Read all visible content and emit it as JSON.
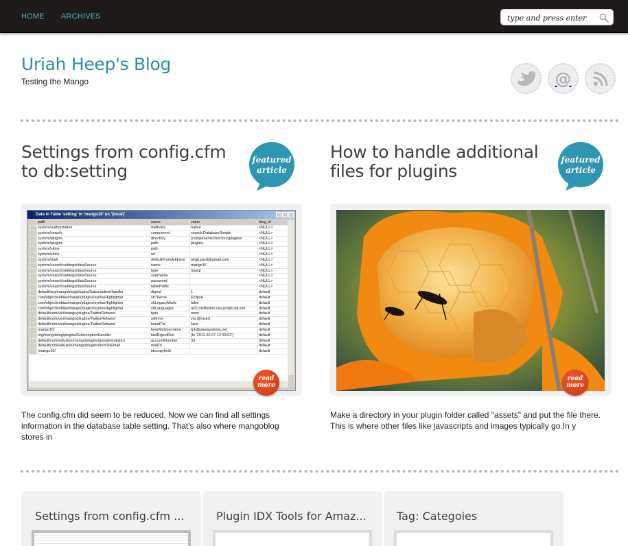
{
  "nav": {
    "home": "HOME",
    "archives": "ARCHIVES"
  },
  "search": {
    "placeholder": "type and press enter"
  },
  "site": {
    "title": "Uriah Heep's Blog",
    "tagline": "Testing the Mango"
  },
  "social": [
    "twitter-icon",
    "email-icon",
    "rss-icon"
  ],
  "badge": {
    "line1": "featured",
    "line2": "article"
  },
  "readmore": {
    "line1": "read",
    "line2": "more"
  },
  "featured": [
    {
      "title": "Settings from config.cfm to db:setting",
      "excerpt": "The config.cfm did seem to be reduced. Now we can find all settings information in the database table setting. That's also where mangoblog stores in"
    },
    {
      "title": "How to handle additional files for plugins",
      "excerpt": "Make a directory in your plugin folder called \"assets\" and put the file there. This is where other files like javascripts and images typically go.In y"
    }
  ],
  "cards": [
    {
      "title": "Settings from config.cfm ..."
    },
    {
      "title": "Plugin IDX Tools for Amaz..."
    },
    {
      "title": "Tag: Categoies"
    }
  ],
  "screenshot": {
    "window_title": "Data in Table 'setting' in 'mango16' on '(local)'",
    "columns": [
      "path",
      "name",
      "value",
      "blog_id"
    ],
    "rows": [
      [
        "system/authorization",
        "methods",
        "native",
        "<NULL>"
      ],
      [
        "system/search",
        "component",
        "search.DatabaseSimple",
        "<NULL>"
      ],
      [
        "system/plugins",
        "directory",
        "{componentsDirectory}plugins/",
        "<NULL>"
      ],
      [
        "system/plugins",
        "path",
        "plugins.",
        "<NULL>"
      ],
      [
        "system/skins",
        "path",
        "",
        "<NULL>"
      ],
      [
        "system/skins",
        "url",
        "",
        "<NULL>"
      ],
      [
        "system/mail",
        "defaultFromAddress",
        "birgit.pauli@gmail.com",
        "<NULL>"
      ],
      [
        "system/search/settings/dataSource",
        "name",
        "mango16",
        "<NULL>"
      ],
      [
        "system/search/settings/dataSource",
        "type",
        "mssql",
        "<NULL>"
      ],
      [
        "system/search/settings/dataSource",
        "username",
        "",
        "<NULL>"
      ],
      [
        "system/search/settings/dataSource",
        "password",
        "",
        "<NULL>"
      ],
      [
        "system/search/settings/dataSource",
        "tablePrefix",
        "",
        "<NULL>"
      ],
      [
        "default/org/mangoblog/plugins/SubscriptionHandler",
        "digest",
        "1",
        "default"
      ],
      [
        "com/objectivebias/mango/plugins/syntaxHighlighter",
        "shTheme",
        "Eclipse",
        "default"
      ],
      [
        "com/objectivebias/mango/plugins/syntaxHighlighter",
        "shLegacyMode",
        "false",
        "default"
      ],
      [
        "com/objectivebias/mango/plugins/syntaxHighlighter",
        "shLanguages",
        "as3,coldfusion,css,jscript,sql,xml",
        "default"
      ],
      [
        "default/com/visi/mango/plugins/TwitterRetweet",
        "type",
        "none",
        "default"
      ],
      [
        "default/com/visi/mango/plugins/TwitterRetweet",
        "referrer",
        "via @{user}",
        "default"
      ],
      [
        "default/com/visi/mango/plugins/TwitterRetweet",
        "tweetTxt",
        "New",
        "default"
      ],
      [
        "mango16/",
        "beerMeUsername",
        "tph@paulsystems.net",
        "default"
      ],
      [
        "org/mangoblog/plugins/SubscriptionHandler",
        "lastDigestRun",
        "{ts '2011-02-07 12:33:02'}",
        "default"
      ],
      [
        "default/com/asfusion/mango/plugins/googleanalytics",
        "accountNumber",
        "33",
        "default"
      ],
      [
        "default/com/asfusion/mango/plugins/formToEmail",
        "mailTo",
        "",
        "default"
      ],
      [
        "/mango16/",
        "idxcopyfield",
        "",
        "default"
      ]
    ]
  }
}
